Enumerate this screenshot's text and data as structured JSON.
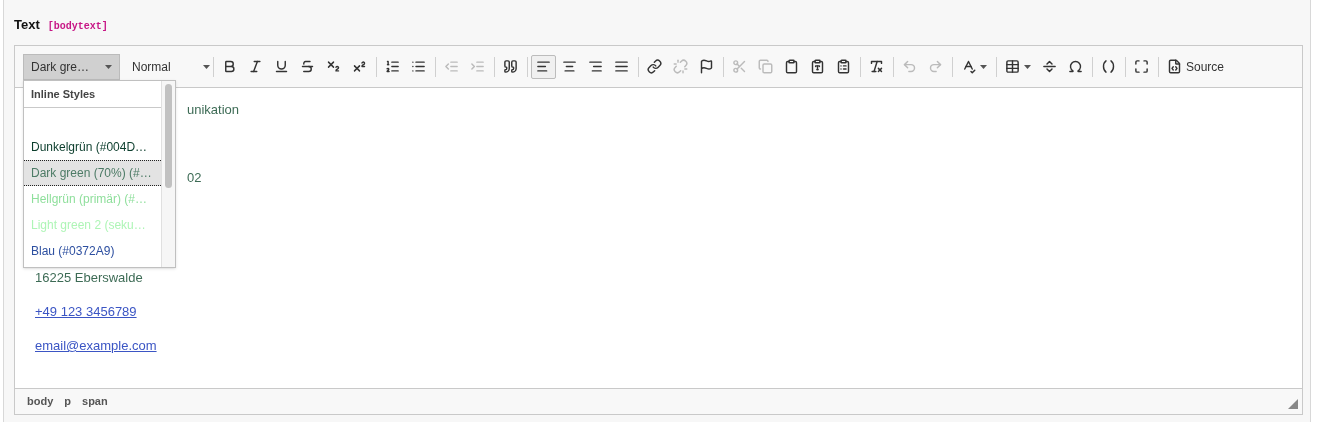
{
  "field": {
    "label": "Text",
    "key": "[bodytext]"
  },
  "toolbar": {
    "style_combo": {
      "value": "Dark gre…",
      "open": true
    },
    "format_combo": {
      "value": "Normal"
    },
    "groups": [
      [
        {
          "kind": "bold",
          "disabled": false,
          "selected": false
        },
        {
          "kind": "italic",
          "disabled": false,
          "selected": false
        },
        {
          "kind": "underline",
          "disabled": false,
          "selected": false
        },
        {
          "kind": "strike",
          "disabled": false,
          "selected": false
        },
        {
          "kind": "subscript",
          "disabled": false,
          "selected": false
        },
        {
          "kind": "superscript",
          "disabled": false,
          "selected": false
        }
      ],
      [
        {
          "kind": "ordered-list",
          "disabled": false,
          "selected": false
        },
        {
          "kind": "bullet-list",
          "disabled": false,
          "selected": false
        }
      ],
      [
        {
          "kind": "outdent",
          "disabled": true,
          "selected": false
        },
        {
          "kind": "indent",
          "disabled": true,
          "selected": false
        }
      ],
      [
        {
          "kind": "blockquote",
          "disabled": false,
          "selected": false
        }
      ],
      [
        {
          "kind": "align-left",
          "disabled": false,
          "selected": true
        },
        {
          "kind": "align-center",
          "disabled": false,
          "selected": false
        },
        {
          "kind": "align-right",
          "disabled": false,
          "selected": false
        },
        {
          "kind": "align-justify",
          "disabled": false,
          "selected": false
        }
      ],
      [
        {
          "kind": "link",
          "disabled": false,
          "selected": false
        },
        {
          "kind": "unlink",
          "disabled": true,
          "selected": false
        },
        {
          "kind": "anchor",
          "disabled": false,
          "selected": false
        }
      ],
      [
        {
          "kind": "cut",
          "disabled": true,
          "selected": false
        },
        {
          "kind": "copy",
          "disabled": true,
          "selected": false
        },
        {
          "kind": "paste",
          "disabled": false,
          "selected": false
        },
        {
          "kind": "paste-text",
          "disabled": false,
          "selected": false
        },
        {
          "kind": "paste-word",
          "disabled": false,
          "selected": false
        }
      ],
      [
        {
          "kind": "remove-format",
          "disabled": false,
          "selected": false
        }
      ],
      [
        {
          "kind": "undo",
          "disabled": true,
          "selected": false
        },
        {
          "kind": "redo",
          "disabled": true,
          "selected": false
        }
      ],
      [
        {
          "kind": "spellcheck",
          "disabled": false,
          "selected": false
        }
      ],
      [
        {
          "kind": "table",
          "disabled": false,
          "selected": false
        },
        {
          "kind": "horizontal-rule",
          "disabled": false,
          "selected": false
        },
        {
          "kind": "special-char",
          "disabled": false,
          "selected": false
        }
      ],
      [
        {
          "kind": "soft-hyphen",
          "disabled": false,
          "selected": false
        }
      ],
      [
        {
          "kind": "maximize",
          "disabled": false,
          "selected": false
        }
      ],
      [
        {
          "kind": "source",
          "label": "Source",
          "disabled": false,
          "selected": false
        }
      ]
    ]
  },
  "style_menu": {
    "heading": "Inline Styles",
    "items": [
      {
        "label": "Dunkelgrün (#004D…",
        "color": "#0b3d2c",
        "selected": false
      },
      {
        "label": "Dark green (70%) (#…",
        "color": "#4d7b66",
        "selected": true
      },
      {
        "label": "Hellgrün (primär) (#…",
        "color": "#8fdf9c",
        "selected": false
      },
      {
        "label": "Light green 2 (seku…",
        "color": "#aef5b6",
        "selected": false
      },
      {
        "label": "Blau (#0372A9)",
        "color": "#2d4fa0",
        "selected": false
      }
    ]
  },
  "content": [
    {
      "kind": "text",
      "text": "unikation"
    },
    {
      "kind": "blank"
    },
    {
      "kind": "text",
      "text": "02"
    },
    {
      "kind": "blank"
    },
    {
      "kind": "text",
      "text": "16225 Eberswalde"
    },
    {
      "kind": "link",
      "text": "+49 123 3456789"
    },
    {
      "kind": "link",
      "text": "email@example.com"
    }
  ],
  "path": [
    "body",
    "p",
    "span"
  ]
}
